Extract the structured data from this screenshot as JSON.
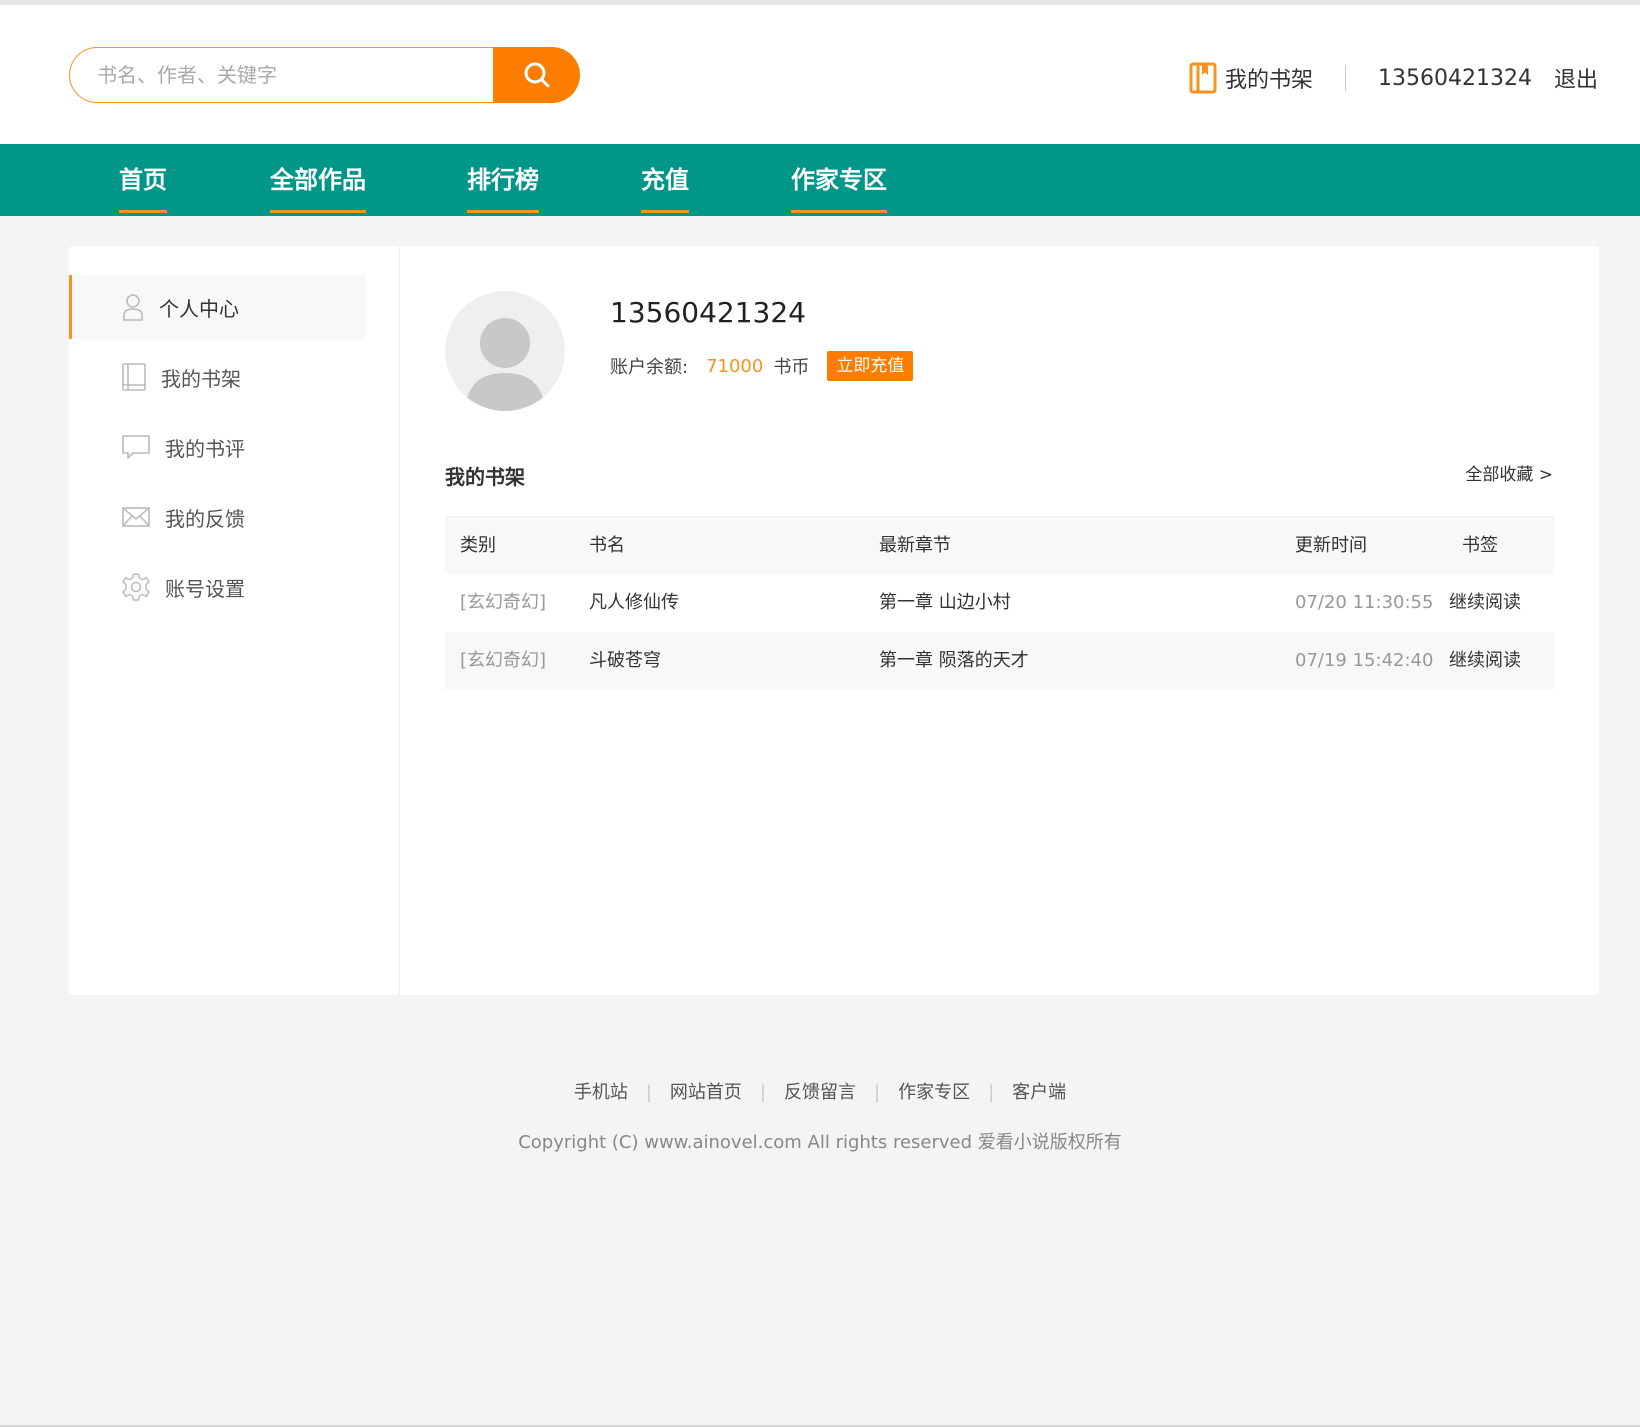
{
  "search": {
    "placeholder": "书名、作者、关键字"
  },
  "header": {
    "shelf_label": "我的书架",
    "phone": "13560421324",
    "logout_label": "退出"
  },
  "nav": {
    "items": [
      "首页",
      "全部作品",
      "排行榜",
      "充值",
      "作家专区"
    ]
  },
  "sidebar": {
    "items": [
      "个人中心",
      "我的书架",
      "我的书评",
      "我的反馈",
      "账号设置"
    ]
  },
  "profile": {
    "username": "13560421324",
    "balance_label": "账户余额:",
    "balance_amount": "71000",
    "balance_unit": "书币",
    "recharge_label": "立即充值"
  },
  "shelf": {
    "title": "我的书架",
    "all_link": "全部收藏 >",
    "columns": [
      "类别",
      "书名",
      "最新章节",
      "更新时间",
      "书签"
    ],
    "rows": [
      {
        "category": "[玄幻奇幻]",
        "name": "凡人修仙传",
        "chapter": "第一章 山边小村",
        "time": "07/20 11:30:55",
        "action": "继续阅读"
      },
      {
        "category": "[玄幻奇幻]",
        "name": "斗破苍穹",
        "chapter": "第一章 陨落的天才",
        "time": "07/19 15:42:40",
        "action": "继续阅读"
      }
    ]
  },
  "footer": {
    "links": [
      "手机站",
      "网站首页",
      "反馈留言",
      "作家专区",
      "客户端"
    ],
    "copyright": "Copyright (C) www.ainovel.com All rights reserved 爱看小说版权所有"
  },
  "colors": {
    "accent": "#f7931e",
    "nav_bg": "#009688",
    "button": "#fd7d00"
  }
}
